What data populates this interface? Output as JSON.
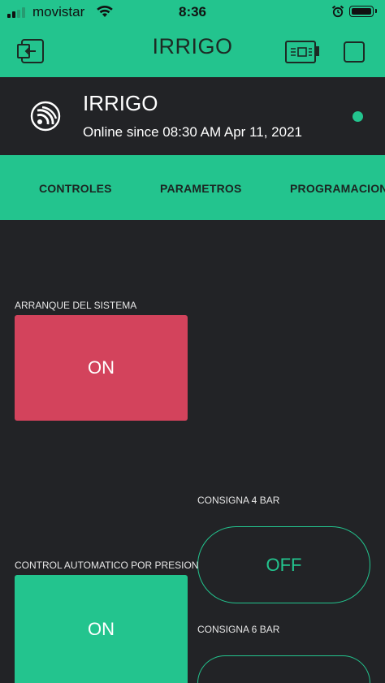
{
  "status_bar": {
    "carrier": "movistar",
    "time": "8:36"
  },
  "header": {
    "title": "IRRIGO"
  },
  "device": {
    "name": "IRRIGO",
    "status": "Online since 08:30 AM Apr 11, 2021",
    "online": true
  },
  "tabs": [
    {
      "label": "CONTROLES"
    },
    {
      "label": "PARAMETROS"
    },
    {
      "label": "PROGRAMACION"
    }
  ],
  "widgets": {
    "system_start": {
      "label": "ARRANQUE DEL SISTEMA",
      "value": "ON"
    },
    "auto_pressure": {
      "label": "CONTROL AUTOMATICO POR PRESION",
      "value": "ON"
    },
    "setpoint_4bar": {
      "label": "CONSIGNA 4 BAR",
      "value": "OFF"
    },
    "setpoint_6bar": {
      "label": "CONSIGNA 6 BAR",
      "value": ""
    }
  },
  "colors": {
    "accent": "#23c48e",
    "background": "#222326",
    "button_red": "#d3435c",
    "text_dark": "#1c2522"
  },
  "icons": {
    "exit": "exit-app-icon",
    "device": "device-board-icon",
    "square": "square-icon",
    "device_logo": "espressif-logo-icon"
  }
}
